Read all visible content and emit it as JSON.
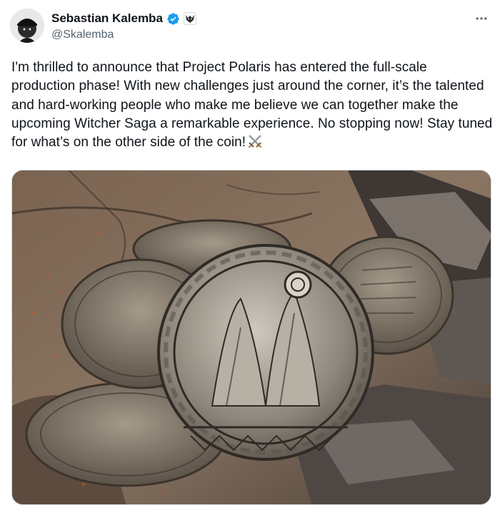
{
  "author": {
    "display_name": "Sebastian Kalemba",
    "handle": "@Skalemba",
    "verified": true,
    "avatar_icon": "user-avatar-icon",
    "affiliate_badge_icon": "wolf-badge-icon"
  },
  "post": {
    "text": "I'm thrilled to announce that Project Polaris has entered the full-scale production phase! With new challenges just around the corner, it’s the talented and hard-working people who make me believe we can together make the upcoming Witcher Saga a remarkable experience. No stopping now! Stay tuned for what’s on the other side of the coin!",
    "emoji_icon": "crossed-swords-icon"
  },
  "menu": {
    "icon": "more-options-icon"
  },
  "colors": {
    "text": "#0f1419",
    "secondary": "#536471",
    "verified": "#1d9bf0"
  }
}
